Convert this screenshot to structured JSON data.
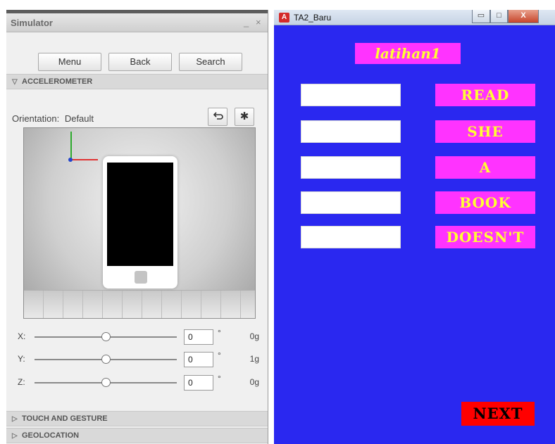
{
  "simulator": {
    "title": "Simulator",
    "min_glyph": "_",
    "close_glyph": "×",
    "buttons": {
      "menu": "Menu",
      "back": "Back",
      "search": "Search"
    },
    "accelerometer": {
      "section_label": "ACCELEROMETER",
      "orientation_label": "Orientation:",
      "orientation_value": "Default",
      "axes": [
        {
          "label": "X:",
          "value": "0",
          "degree": "°",
          "g": "0g"
        },
        {
          "label": "Y:",
          "value": "0",
          "degree": "°",
          "g": "1g"
        },
        {
          "label": "Z:",
          "value": "0",
          "degree": "°",
          "g": "0g"
        }
      ]
    },
    "sections": {
      "touch": "TOUCH AND GESTURE",
      "geolocation": "GEOLOCATION"
    },
    "icons": {
      "reset": "reset-icon",
      "settings": "gear-icon",
      "expanded": "triangle-down-icon",
      "collapsed": "triangle-right-icon"
    }
  },
  "app_window": {
    "title": "TA2_Baru",
    "controls": {
      "minimize": "▭",
      "maximize": "□",
      "close": "X"
    },
    "heading": "latihan1",
    "words": [
      "READ",
      "SHE",
      "A",
      "BOOK",
      "DOESN'T"
    ],
    "next_label": "NEXT",
    "colors": {
      "background": "#2a28f0",
      "word_box": "#ff33ff",
      "word_text": "#ffff33",
      "next_button": "#ff0000"
    }
  }
}
